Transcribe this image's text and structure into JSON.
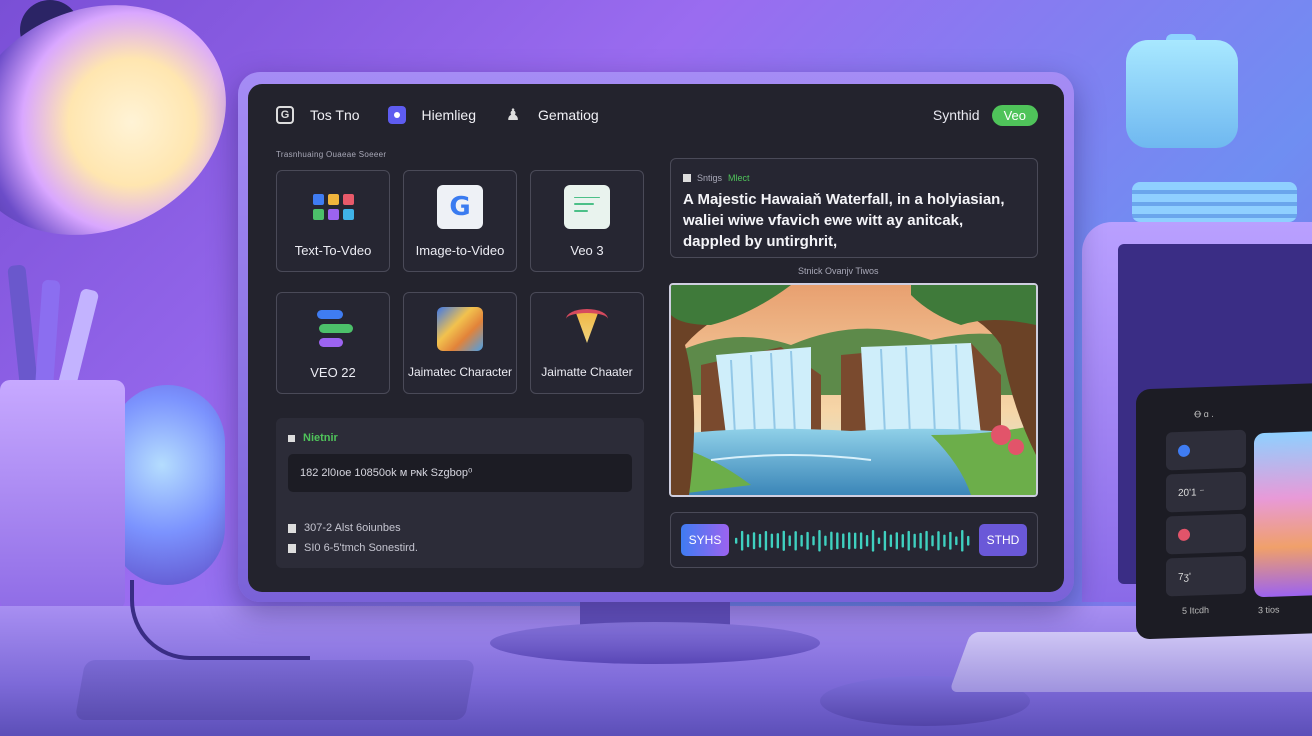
{
  "header": {
    "nav": [
      {
        "label": "Tos Tno",
        "icon": "app-box-icon"
      },
      {
        "label": "Hiemlieg",
        "icon": "purple-dot-icon"
      },
      {
        "label": "Gematiog",
        "icon": "person-icon"
      }
    ],
    "brand": "Synthid",
    "badge": "Veo"
  },
  "tools": {
    "section_label": "Trasnhuaing Ouaeae  Soeeer",
    "tiles": [
      {
        "label": "Text-To-Vdeo",
        "icon": "grid-icon"
      },
      {
        "label": "Image-to-Video",
        "icon": "g-logo-icon"
      },
      {
        "label": "Veo 3",
        "icon": "note-icon"
      },
      {
        "label": "VEO 22",
        "icon": "veo2-icon"
      },
      {
        "label": "Jaimatec Character",
        "icon": "character-icon"
      },
      {
        "label": "Jaimatte Chaater",
        "icon": "character-face-icon"
      }
    ]
  },
  "panel": {
    "title": "Nietnir",
    "field": "182 2l0ıoe 10850ok ᴍ ᴘɴk Szgbop⁰",
    "lines": [
      "307-2  Alst 6oiunbes",
      "SI0  6-5'tmch Sonestird."
    ]
  },
  "prompt": {
    "header": "Sntigs",
    "header_accent": "Mlect",
    "text": "A Majestic Hawaiaň Waterfall, in a holyiasian, waliei wiwe vfavich ewe witt ay anitcak, dappled by untirghrit,"
  },
  "preview": {
    "label": "Stnick Ovanjv Tiwos"
  },
  "audio": {
    "left_label": "SYHS",
    "right_label": "STHD"
  },
  "laptop": {
    "header": "Ꝋ ɑ .",
    "rows": [
      "",
      "20ʹ1 ⁻",
      "",
      "7ʒ'"
    ],
    "footer_left": "5 Itcdh",
    "footer_right": "3 tios"
  },
  "colors": {
    "accent_green": "#4fc35a",
    "screen_bg": "#23232d",
    "wave_teal": "#3fd1c0"
  }
}
